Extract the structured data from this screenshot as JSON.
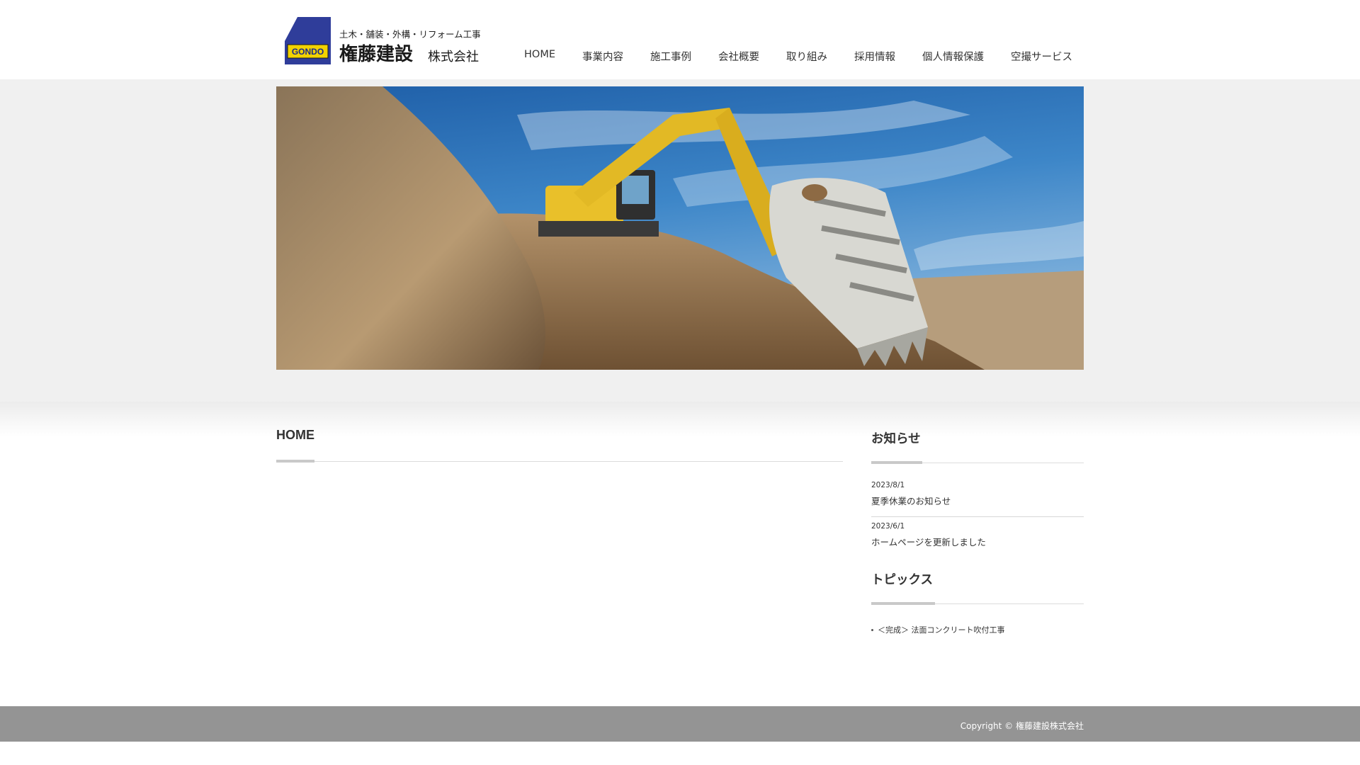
{
  "logo": {
    "tagline": "土木・舗装・外構・リフォーム工事",
    "company_name": "権藤建設",
    "company_suffix": "株式会社",
    "mark_text": "GONDO"
  },
  "nav": {
    "items": [
      {
        "label": "HOME"
      },
      {
        "label": "事業内容"
      },
      {
        "label": "施工事例"
      },
      {
        "label": "会社概要"
      },
      {
        "label": "取り組み"
      },
      {
        "label": "採用情報"
      },
      {
        "label": "個人情報保護"
      },
      {
        "label": "空撮サービス"
      }
    ]
  },
  "main": {
    "title": "HOME"
  },
  "sidebar": {
    "news_heading": "お知らせ",
    "news": [
      {
        "date": "2023/8/1",
        "title": "夏季休業のお知らせ"
      },
      {
        "date": "2023/6/1",
        "title": "ホームページを更新しました"
      }
    ],
    "topics_heading": "トピックス",
    "topics": [
      {
        "title": "＜完成＞ 法面コンクリート吹付工事"
      }
    ]
  },
  "footer": {
    "copyright": "Copyright ©  権藤建設株式会社"
  },
  "colors": {
    "brand_blue": "#2f3d9a",
    "brand_yellow": "#f2d200",
    "footer_gray": "#949494",
    "band_gray": "#f0f0f0"
  }
}
